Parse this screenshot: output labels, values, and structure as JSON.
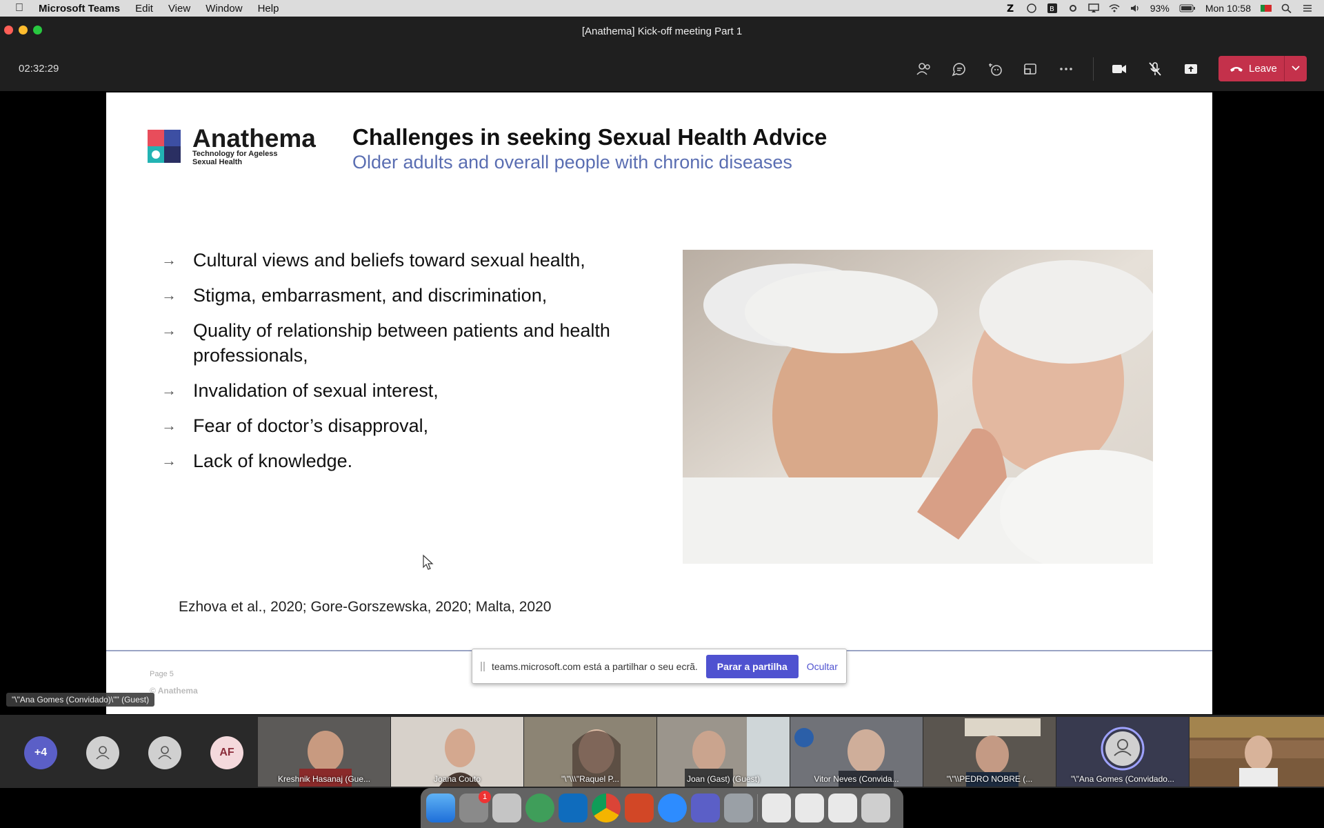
{
  "menubar": {
    "app_name": "Microsoft Teams",
    "items": [
      "Edit",
      "View",
      "Window",
      "Help"
    ],
    "battery": "93%",
    "clock": "Mon 10:58"
  },
  "window": {
    "title": "[Anathema] Kick-off meeting Part 1",
    "timer": "02:32:29",
    "leave_label": "Leave"
  },
  "slide": {
    "logo_name": "Anathema",
    "logo_tagline_1": "Technology for Ageless",
    "logo_tagline_2": "Sexual Health",
    "title": "Challenges in seeking Sexual Health Advice",
    "subtitle": "Older adults and overall people with chronic diseases",
    "bullets": [
      "Cultural views and beliefs toward sexual health,",
      "Stigma, embarrasment, and discrimination,",
      "Quality of relationship between patients and health professionals,",
      "Invalidation of sexual interest,",
      "Fear of doctor’s disapproval,",
      "Lack of knowledge."
    ],
    "citation": "Ezhova et al., 2020; Gore-Gorszewska, 2020; Malta, 2020",
    "page_label": "Page 5",
    "copyright": "© Anathema"
  },
  "share_bar": {
    "message": "teams.microsoft.com está a partilhar o seu ecrã.",
    "stop_label": "Parar a partilha",
    "hide_label": "Ocultar"
  },
  "speaker_label": "\"\\\"Ana Gomes (Convidado)\\\"\" (Guest)",
  "participants": {
    "overflow_count": "+4",
    "initials": "AF",
    "tiles": [
      "Kreshnik Hasanaj (Gue...",
      "Joana Couto",
      "\"\\\"\\\\\\\"Raquel P...",
      "Joan (Gast) (Guest)",
      "Vitor Neves (Convida...",
      "\"\\\"\\\\PEDRO NOBRE (...",
      "\"\\\"Ana Gomes (Convidado...",
      ""
    ]
  },
  "dock": {
    "badge_count": "1"
  },
  "colors": {
    "leave": "#c4314b",
    "accent": "#4f52d0",
    "subtitle": "#5a6eb2"
  }
}
